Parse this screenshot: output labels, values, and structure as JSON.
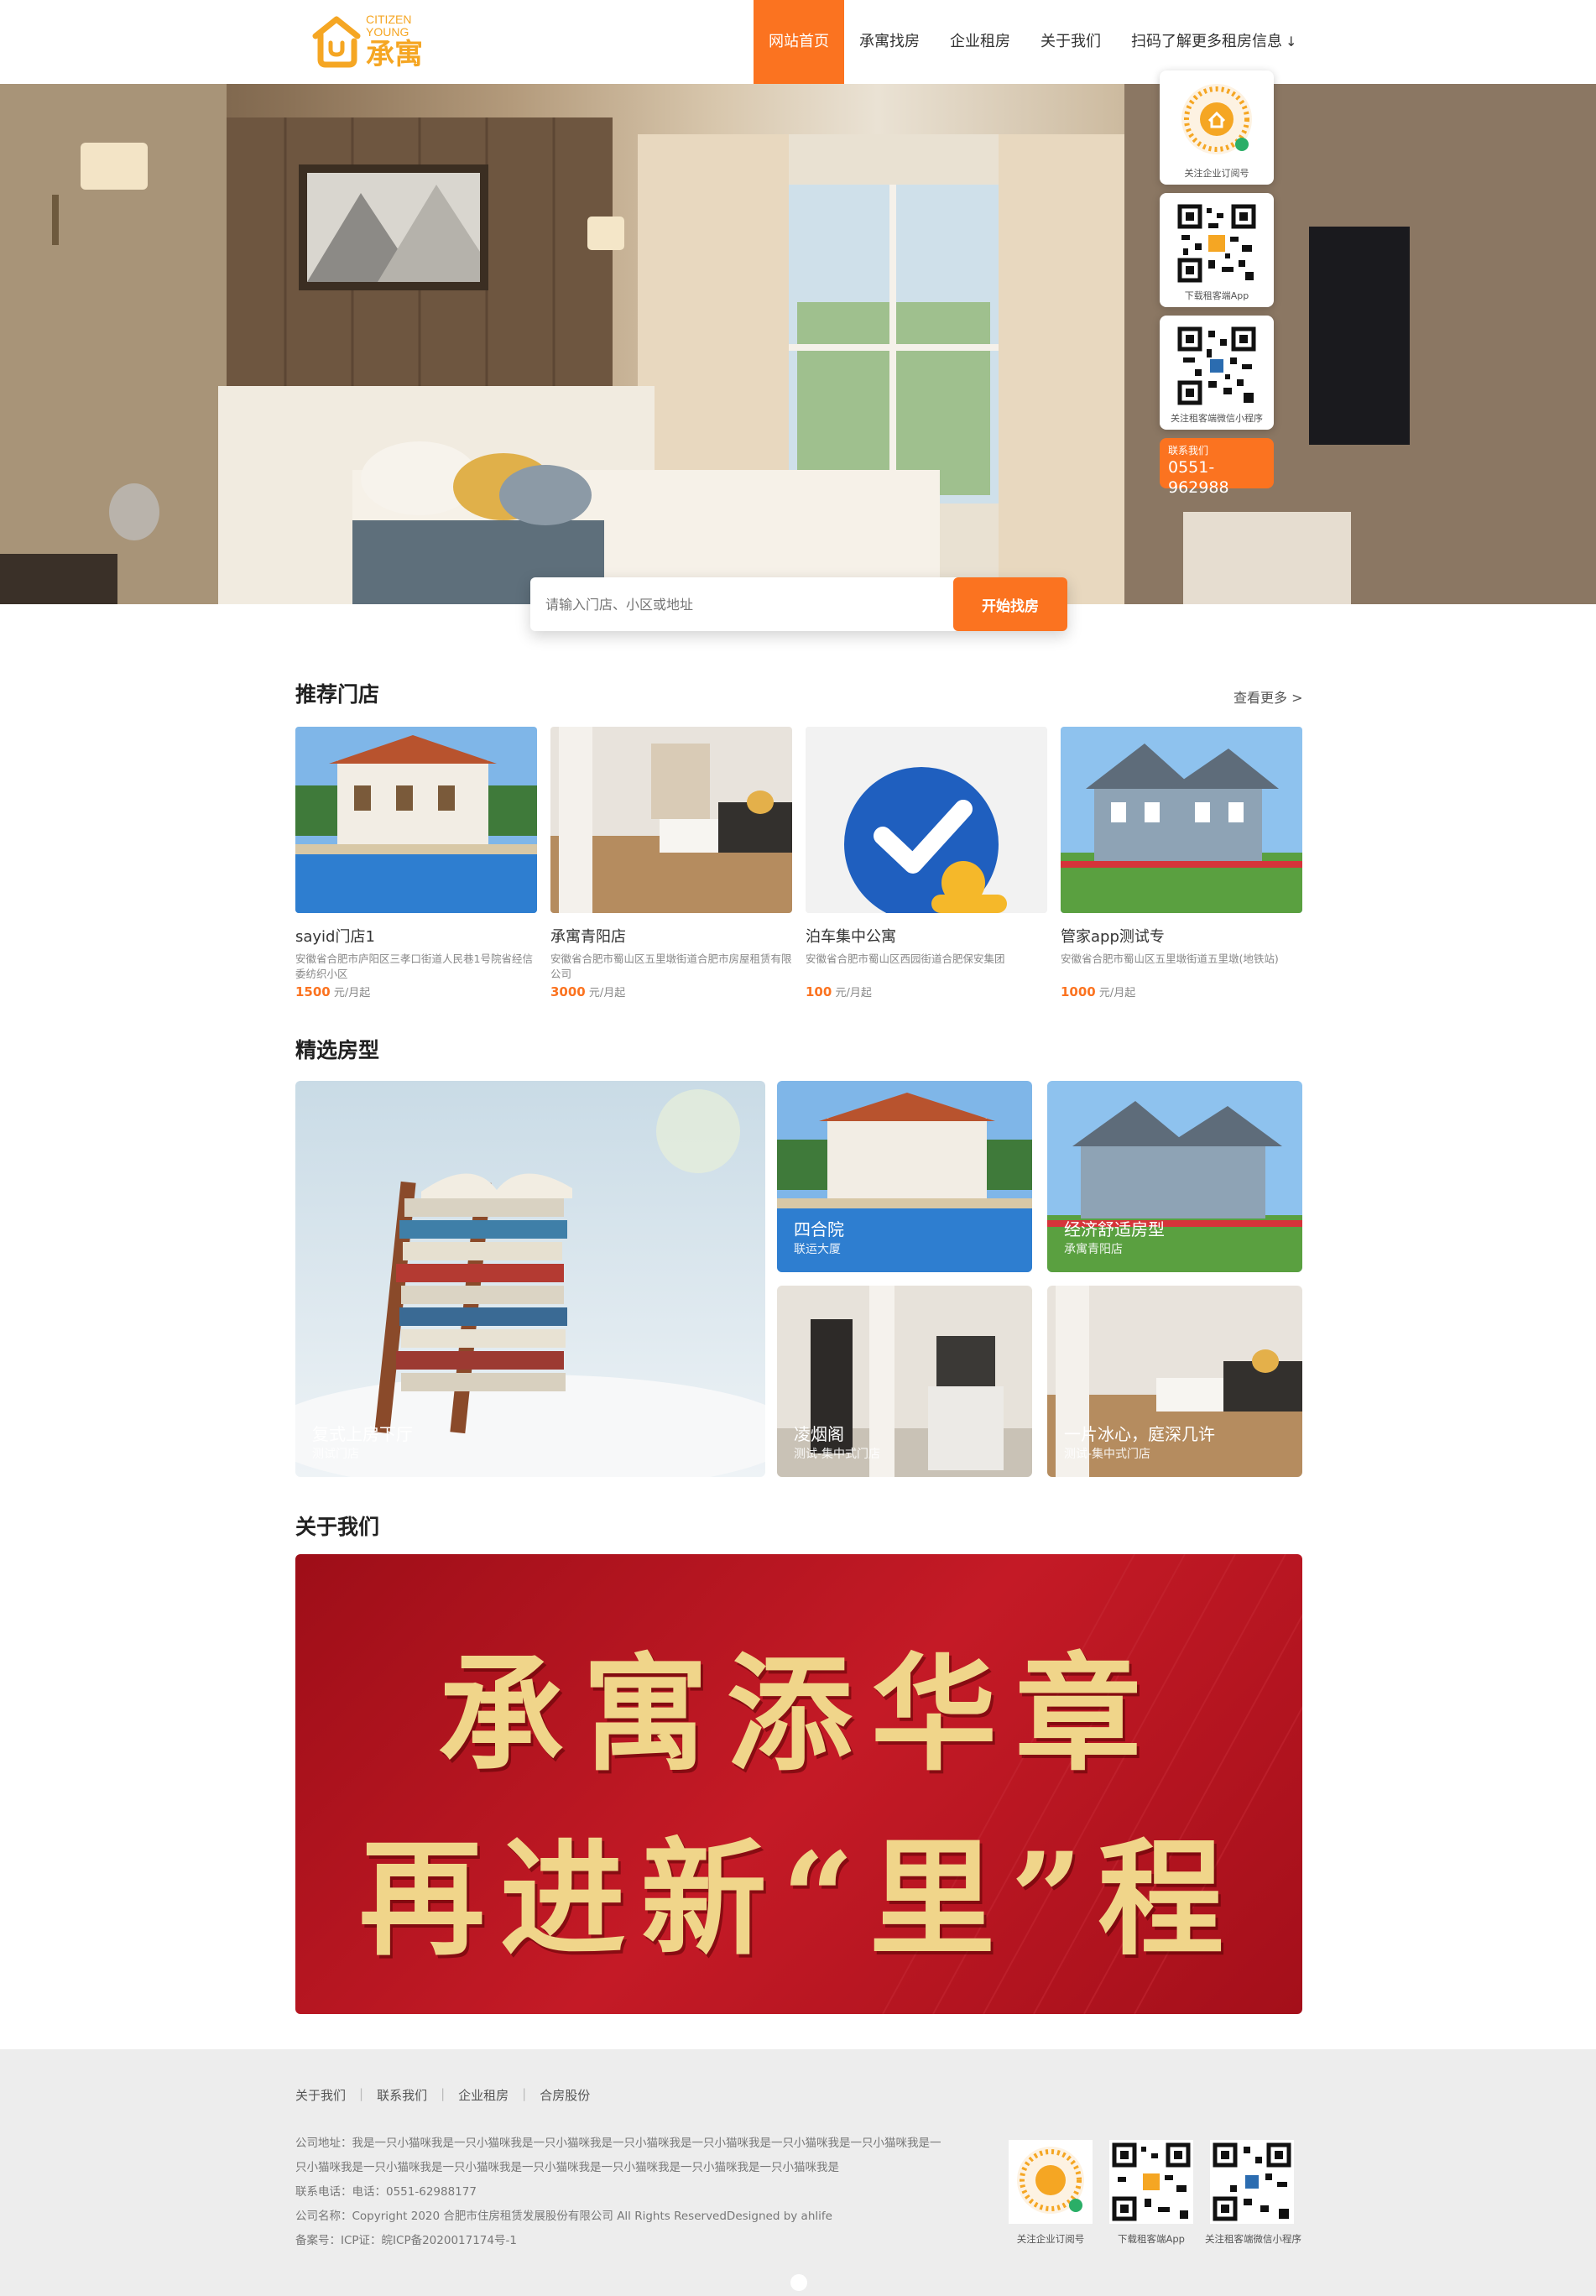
{
  "brand": {
    "name_en_1": "CITIZEN",
    "name_en_2": "YOUNG",
    "name_cn": "承寓"
  },
  "nav": {
    "items": [
      {
        "label": "网站首页"
      },
      {
        "label": "承寓找房"
      },
      {
        "label": "企业租房"
      },
      {
        "label": "关于我们"
      },
      {
        "label": "扫码了解更多租房信息"
      }
    ],
    "arrow": "↓"
  },
  "search": {
    "placeholder": "请输入门店、小区或地址",
    "button": "开始找房"
  },
  "floatbar": {
    "cards": [
      {
        "caption": "关注企业订阅号"
      },
      {
        "caption": "下载租客端App"
      },
      {
        "caption": "关注租客端微信小程序"
      }
    ],
    "contact_label": "联系我们",
    "contact_phone": "0551-962988"
  },
  "stores": {
    "title": "推荐门店",
    "more": "查看更多 >",
    "items": [
      {
        "name": "sayid门店1",
        "address": "安徽省合肥市庐阳区三孝口街道人民巷1号院省经信委纺织小区",
        "price": "1500",
        "unit": "元/月起"
      },
      {
        "name": "承寓青阳店",
        "address": "安徽省合肥市蜀山区五里墩街道合肥市房屋租赁有限公司",
        "price": "3000",
        "unit": "元/月起"
      },
      {
        "name": "泊车集中公寓",
        "address": "安徽省合肥市蜀山区西园街道合肥保安集团",
        "price": "100",
        "unit": "元/月起"
      },
      {
        "name": "管家app测试专",
        "address": "安徽省合肥市蜀山区五里墩街道五里墩(地铁站)",
        "price": "1000",
        "unit": "元/月起"
      }
    ]
  },
  "rooms": {
    "title": "精选房型",
    "items": [
      {
        "title": "复式上房下厅",
        "store": "测试门店"
      },
      {
        "title": "四合院",
        "store": "联运大厦"
      },
      {
        "title": "经济舒适房型",
        "store": "承寓青阳店"
      },
      {
        "title": "凌烟阁",
        "store": "测试-集中式门店"
      },
      {
        "title": "一片冰心，庭深几许",
        "store": "测试-集中式门店"
      }
    ]
  },
  "about": {
    "title": "关于我们",
    "slogan_line1": "承寓添华章",
    "slogan_line2": "再进新“里”程"
  },
  "footer": {
    "links": [
      "关于我们",
      "联系我们",
      "企业租房",
      "合房股份"
    ],
    "separator": "|",
    "address_line1": "公司地址：我是一只小猫咪我是一只小猫咪我是一只小猫咪我是一只小猫咪我是一只小猫咪我是一只小猫咪我是一只小猫咪我是一",
    "address_line2": "只小猫咪我是一只小猫咪我是一只小猫咪我是一只小猫咪我是一只小猫咪我是一只小猫咪我是一只小猫咪我是",
    "phone": "联系电话：电话：0551-62988177",
    "company": "公司名称：Copyright 2020 合肥市住房租赁发展股份有限公司 All Rights ReservedDesigned by ahlife",
    "icp": "备案号：ICP证：皖ICP备2020017174号-1",
    "qrs": [
      {
        "caption": "关注企业订阅号"
      },
      {
        "caption": "下载租客端App"
      },
      {
        "caption": "关注租客端微信小程序"
      }
    ]
  },
  "colors": {
    "accent": "#fb7320",
    "brand": "#f5a623",
    "banner_red": "#b3121e",
    "slogan_gold": "#f0d58a"
  }
}
